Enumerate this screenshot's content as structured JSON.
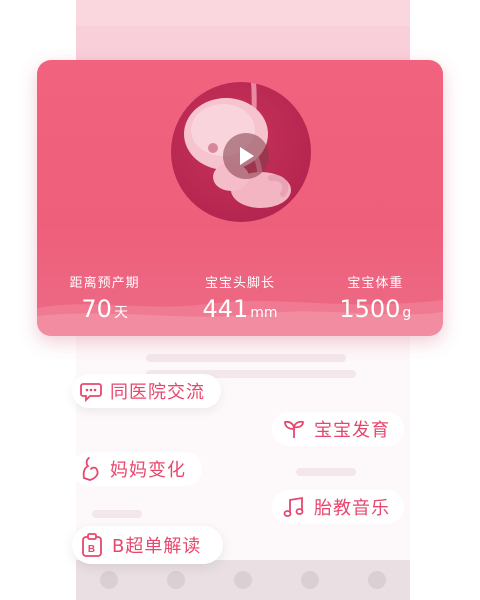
{
  "hero": {
    "stats": [
      {
        "label": "距离预产期",
        "value": "70",
        "unit": "天"
      },
      {
        "label": "宝宝头脚长",
        "value": "441",
        "unit": "mm"
      },
      {
        "label": "宝宝体重",
        "value": "1500",
        "unit": "g"
      }
    ]
  },
  "features": {
    "hospital_chat": "同医院交流",
    "baby_growth": "宝宝发育",
    "mom_changes": "妈妈变化",
    "prenatal_music": "胎教音乐",
    "b_ultrasound": "B超单解读"
  },
  "colors": {
    "accent": "#e8476d",
    "card": "#f0627e"
  }
}
